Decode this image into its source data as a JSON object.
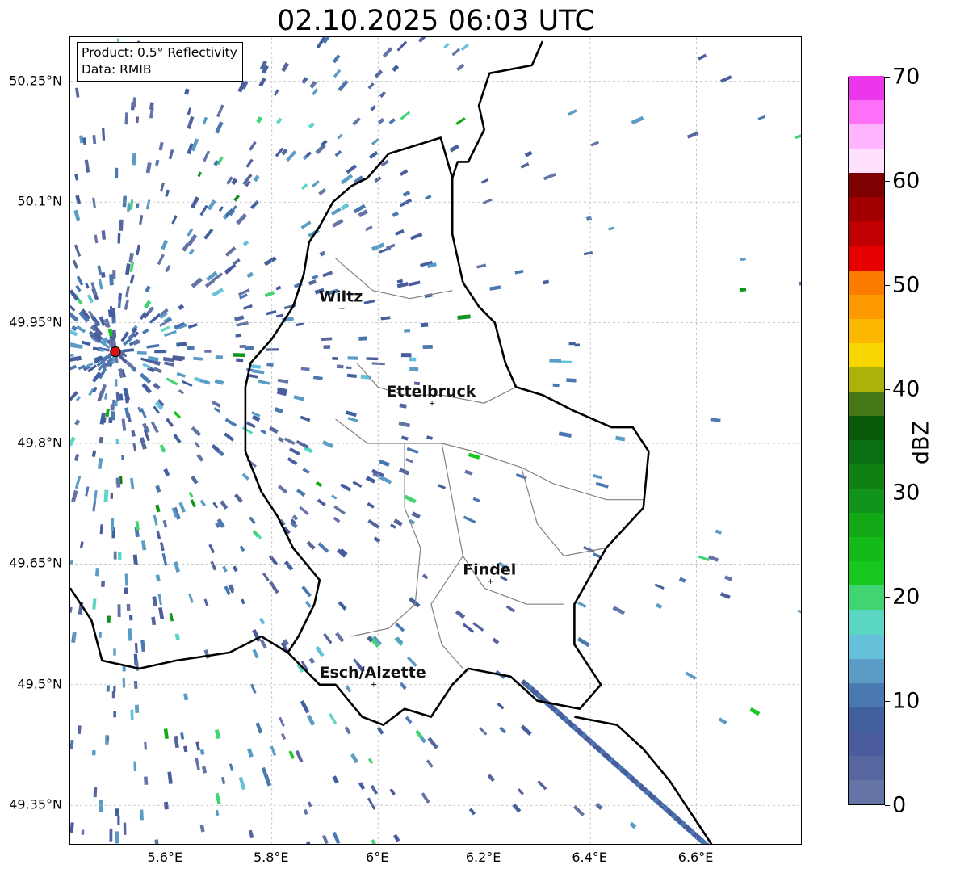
{
  "title": "02.10.2025 06:03 UTC",
  "info": {
    "product": "Product: 0.5° Reflectivity",
    "data": "Data: RMIB"
  },
  "map_extent": {
    "lon": [
      5.42,
      6.8
    ],
    "lat": [
      49.3,
      50.305
    ]
  },
  "lat_ticks": [
    {
      "value": 50.25,
      "label": "50.25°N"
    },
    {
      "value": 50.1,
      "label": "50.1°N"
    },
    {
      "value": 49.95,
      "label": "49.95°N"
    },
    {
      "value": 49.8,
      "label": "49.8°N"
    },
    {
      "value": 49.65,
      "label": "49.65°N"
    },
    {
      "value": 49.5,
      "label": "49.5°N"
    },
    {
      "value": 49.35,
      "label": "49.35°N"
    }
  ],
  "lon_ticks": [
    {
      "value": 5.6,
      "label": "5.6°E"
    },
    {
      "value": 5.8,
      "label": "5.8°E"
    },
    {
      "value": 6.0,
      "label": "6°E"
    },
    {
      "value": 6.2,
      "label": "6.2°E"
    },
    {
      "value": 6.4,
      "label": "6.4°E"
    },
    {
      "value": 6.6,
      "label": "6.6°E"
    }
  ],
  "cities": [
    {
      "name": "Wiltz",
      "lon": 5.93,
      "lat": 49.966
    },
    {
      "name": "Ettelbruck",
      "lon": 6.1,
      "lat": 49.848
    },
    {
      "name": "Findel",
      "lon": 6.21,
      "lat": 49.627
    },
    {
      "name": "Esch/Alzette",
      "lon": 5.99,
      "lat": 49.499
    }
  ],
  "radar_site": {
    "lon": 5.505,
    "lat": 49.914,
    "color": "#e01010"
  },
  "colorbar": {
    "unit": "dBZ",
    "min": 0,
    "max": 70,
    "ticks": [
      {
        "value": 0,
        "label": "0"
      },
      {
        "value": 10,
        "label": "10"
      },
      {
        "value": 20,
        "label": "20"
      },
      {
        "value": 30,
        "label": "30"
      },
      {
        "value": 40,
        "label": "40"
      },
      {
        "value": 50,
        "label": "50"
      },
      {
        "value": 60,
        "label": "60"
      },
      {
        "value": 70,
        "label": "70"
      }
    ],
    "colors": [
      "#6474a6",
      "#56669e",
      "#4a5c9c",
      "#4260a0",
      "#4a78b0",
      "#5a9cc6",
      "#66c2da",
      "#5cd6c4",
      "#40d472",
      "#16c81e",
      "#14ba1a",
      "#12a816",
      "#10941a",
      "#0e8014",
      "#0a6e12",
      "#085a0a",
      "#467818",
      "#acb20a",
      "#f8d600",
      "#fcb800",
      "#fc9a00",
      "#fc7c00",
      "#e60000",
      "#c00000",
      "#a20000",
      "#7e0000",
      "#ffe0ff",
      "#ffb4ff",
      "#ff70f8",
      "#ec36ec"
    ]
  },
  "colors": {
    "border": "#000000",
    "canton": "#808080",
    "grid": "#b0b0b0"
  }
}
